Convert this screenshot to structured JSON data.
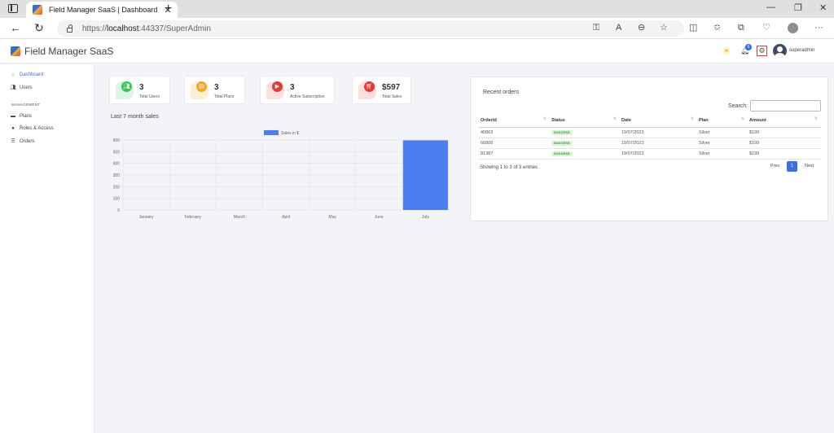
{
  "browser": {
    "tab_title": "Field Manager SaaS | Dashboard",
    "url_prefix": "https://",
    "url_host": "localhost",
    "url_path": ":44337/SuperAdmin"
  },
  "app": {
    "brand": "Field Manager SaaS",
    "notification_count": "6",
    "username": "superadmin"
  },
  "sidebar": {
    "items": [
      {
        "label": "Dashboard",
        "icon": "home-icon",
        "active": true
      },
      {
        "label": "Users",
        "icon": "users-icon"
      }
    ],
    "section_heading": "MANAGEMENT",
    "management_items": [
      {
        "label": "Plans",
        "icon": "credit-card-icon"
      },
      {
        "label": "Roles & Access",
        "icon": "shield-icon"
      },
      {
        "label": "Orders",
        "icon": "list-icon"
      }
    ]
  },
  "stats": [
    {
      "value": "3",
      "label": "Total Users",
      "icon": "users-icon",
      "color": "#34c759",
      "bg": "#dff5e3"
    },
    {
      "value": "3",
      "label": "Total Plans",
      "icon": "briefcase-icon",
      "color": "#f5a623",
      "bg": "#fdefd6"
    },
    {
      "value": "3",
      "label": "Active Subscription",
      "icon": "play-icon",
      "color": "#e53935",
      "bg": "#fde0de"
    },
    {
      "value": "$597",
      "label": "Total Sales",
      "icon": "cart-icon",
      "color": "#e53935",
      "bg": "#fde0de"
    }
  ],
  "sales_chart_title": "Last 7 month sales",
  "chart_data": {
    "type": "bar",
    "categories": [
      "January",
      "February",
      "March",
      "April",
      "May",
      "June",
      "July"
    ],
    "series": [
      {
        "name": "Sales in $",
        "values": [
          0,
          0,
          0,
          0,
          0,
          0,
          597
        ]
      }
    ],
    "y_ticks": [
      "0",
      "100",
      "200",
      "300",
      "400",
      "500",
      "600"
    ],
    "ylim": [
      0,
      600
    ],
    "grid": true,
    "legend": "top-center",
    "bar_color": "#4b7ef0"
  },
  "orders": {
    "title": "Recent orders",
    "search_label": "Search:",
    "search_value": "",
    "columns": [
      "OrderId",
      "Status",
      "Date",
      "Plan",
      "Amount"
    ],
    "rows": [
      [
        "40863",
        "SUCCESS",
        "19/07/2023",
        "Silver",
        "$199"
      ],
      [
        "66808",
        "SUCCESS",
        "19/07/2023",
        "Silver",
        "$199"
      ],
      [
        "81387",
        "SUCCESS",
        "19/07/2023",
        "Silver",
        "$199"
      ]
    ],
    "summary": "Showing 1 to 3 of 3 entries",
    "pager": {
      "prev": "Prev",
      "current": "1",
      "next": "Next"
    }
  }
}
